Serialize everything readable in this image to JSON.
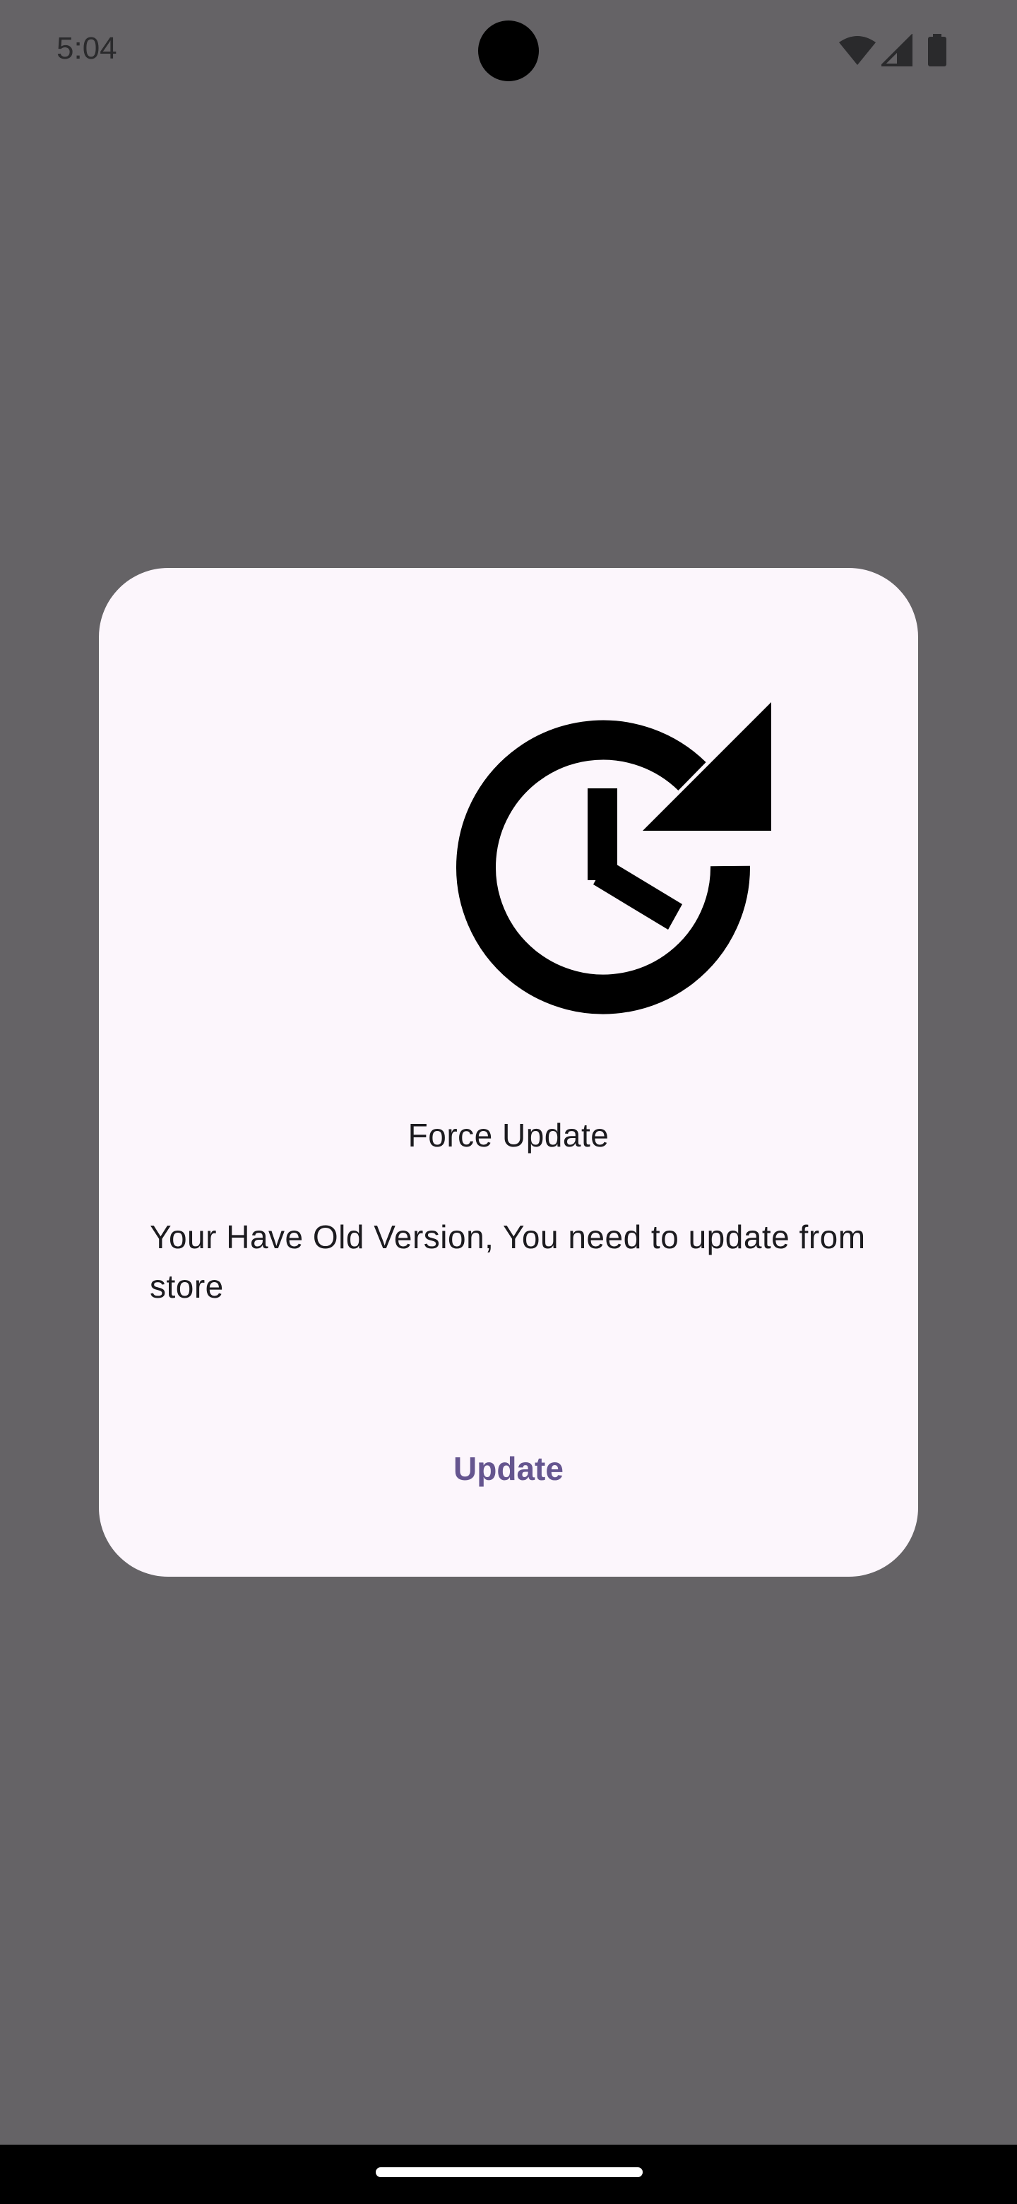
{
  "status_bar": {
    "time": "5:04",
    "icons": [
      "wifi-icon",
      "cellular-signal-icon",
      "battery-icon"
    ]
  },
  "dialog": {
    "icon": "update-clock-icon",
    "title": "Force Update",
    "message": "Your Have Old Version, You need to update from store",
    "button_label": "Update"
  },
  "colors": {
    "scrim": "#656366",
    "dialog_background": "#fcf6fc",
    "button_text": "#65558f",
    "text": "#1c1b1f"
  }
}
